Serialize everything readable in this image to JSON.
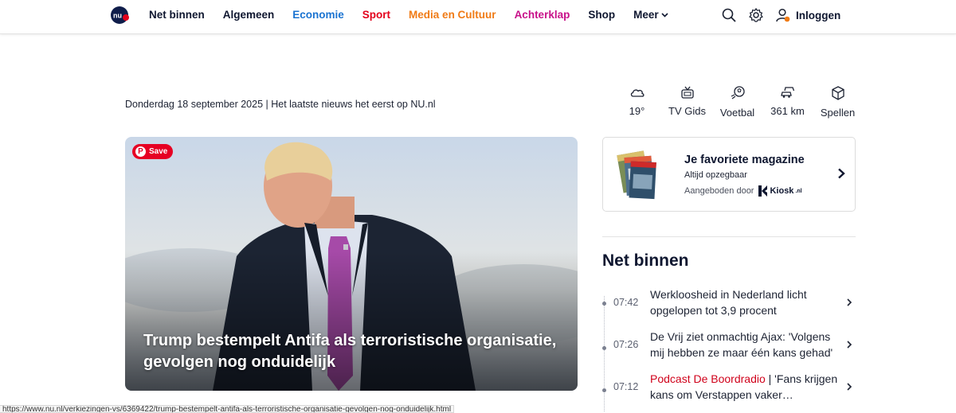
{
  "nav": {
    "items": [
      {
        "label": "Net binnen",
        "color": "#0f1730"
      },
      {
        "label": "Algemeen",
        "color": "#0f1730"
      },
      {
        "label": "Economie",
        "color": "#1a73d1"
      },
      {
        "label": "Sport",
        "color": "#e3001b"
      },
      {
        "label": "Media en Cultuur",
        "color": "#f07b16"
      },
      {
        "label": "Achterklap",
        "color": "#c8118a"
      },
      {
        "label": "Shop",
        "color": "#0f1730"
      },
      {
        "label": "Meer",
        "color": "#0f1730"
      }
    ],
    "login_label": "Inloggen",
    "icons": [
      "search-icon",
      "gear-icon",
      "user-icon"
    ]
  },
  "dateline": "Donderdag 18 september 2025 | Het laatste nieuws het eerst op NU.nl",
  "widgets": [
    {
      "icon": "cloud-icon",
      "label": "19°"
    },
    {
      "icon": "tv-icon",
      "label": "TV Gids"
    },
    {
      "icon": "soccer-icon",
      "label": "Voetbal"
    },
    {
      "icon": "traffic-icon",
      "label": "361 km"
    },
    {
      "icon": "cube-icon",
      "label": "Spellen"
    }
  ],
  "hero": {
    "save_label": "Save",
    "headline": "Trump bestempelt Antifa als terroristische organisatie, gevolgen nog onduidelijk"
  },
  "magazine": {
    "title": "Je favoriete magazine",
    "subtitle": "Altijd opzegbaar",
    "offered_by": "Aangeboden door",
    "brand": "Kiosk",
    "brand_suffix": ".nl"
  },
  "net_binnen": {
    "title": "Net binnen",
    "items": [
      {
        "time": "07:42",
        "prefix": "",
        "text": "Werkloosheid in Nederland licht opgelopen tot 3,9 procent"
      },
      {
        "time": "07:26",
        "prefix": "",
        "text": "De Vrij ziet onmachtig Ajax: 'Volgens mij hebben ze maar één kans gehad'"
      },
      {
        "time": "07:12",
        "prefix": "Podcast De Boordradio",
        "text": " | 'Fans krijgen kans om Verstappen vaker…"
      }
    ]
  },
  "status_url": "https://www.nu.nl/verkiezingen-vs/6369422/trump-bestempelt-antifa-als-terroristische-organisatie-gevolgen-nog-onduidelijk.html"
}
